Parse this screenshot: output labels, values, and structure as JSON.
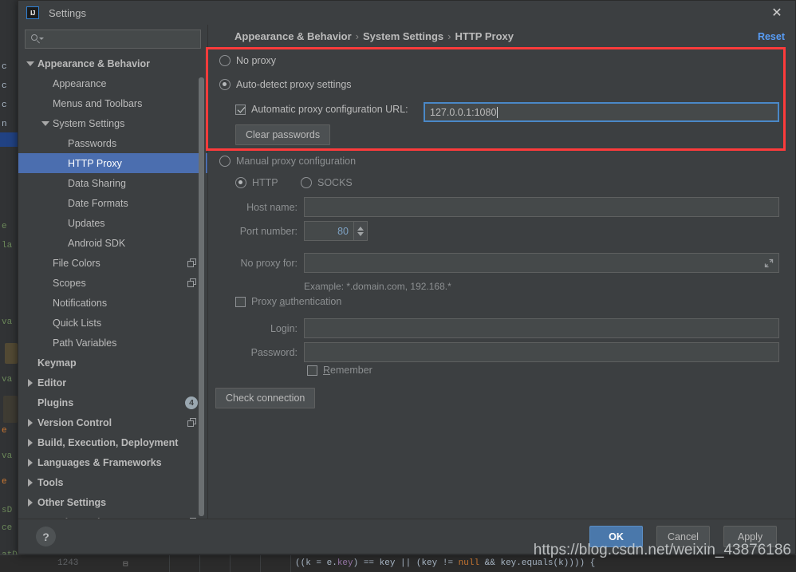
{
  "window": {
    "title": "Settings",
    "logo_text": "IJ",
    "close_label": "✕"
  },
  "search": {
    "value": "",
    "placeholder": ""
  },
  "sidebar": {
    "items": [
      {
        "label": "Appearance & Behavior",
        "indent": 0,
        "twisty": "down",
        "bold": true,
        "selected": false,
        "icon": "",
        "badge": ""
      },
      {
        "label": "Appearance",
        "indent": 1,
        "twisty": "none",
        "bold": false,
        "selected": false,
        "icon": "",
        "badge": ""
      },
      {
        "label": "Menus and Toolbars",
        "indent": 1,
        "twisty": "none",
        "bold": false,
        "selected": false,
        "icon": "",
        "badge": ""
      },
      {
        "label": "System Settings",
        "indent": 1,
        "twisty": "down",
        "bold": false,
        "selected": false,
        "icon": "",
        "badge": ""
      },
      {
        "label": "Passwords",
        "indent": 2,
        "twisty": "none",
        "bold": false,
        "selected": false,
        "icon": "",
        "badge": ""
      },
      {
        "label": "HTTP Proxy",
        "indent": 2,
        "twisty": "none",
        "bold": false,
        "selected": true,
        "icon": "",
        "badge": ""
      },
      {
        "label": "Data Sharing",
        "indent": 2,
        "twisty": "none",
        "bold": false,
        "selected": false,
        "icon": "",
        "badge": ""
      },
      {
        "label": "Date Formats",
        "indent": 2,
        "twisty": "none",
        "bold": false,
        "selected": false,
        "icon": "",
        "badge": ""
      },
      {
        "label": "Updates",
        "indent": 2,
        "twisty": "none",
        "bold": false,
        "selected": false,
        "icon": "",
        "badge": ""
      },
      {
        "label": "Android SDK",
        "indent": 2,
        "twisty": "none",
        "bold": false,
        "selected": false,
        "icon": "",
        "badge": ""
      },
      {
        "label": "File Colors",
        "indent": 1,
        "twisty": "none",
        "bold": false,
        "selected": false,
        "icon": "copy-icon",
        "badge": ""
      },
      {
        "label": "Scopes",
        "indent": 1,
        "twisty": "none",
        "bold": false,
        "selected": false,
        "icon": "copy-icon",
        "badge": ""
      },
      {
        "label": "Notifications",
        "indent": 1,
        "twisty": "none",
        "bold": false,
        "selected": false,
        "icon": "",
        "badge": ""
      },
      {
        "label": "Quick Lists",
        "indent": 1,
        "twisty": "none",
        "bold": false,
        "selected": false,
        "icon": "",
        "badge": ""
      },
      {
        "label": "Path Variables",
        "indent": 1,
        "twisty": "none",
        "bold": false,
        "selected": false,
        "icon": "",
        "badge": ""
      },
      {
        "label": "Keymap",
        "indent": 0,
        "twisty": "none",
        "bold": true,
        "selected": false,
        "icon": "",
        "badge": ""
      },
      {
        "label": "Editor",
        "indent": 0,
        "twisty": "right",
        "bold": true,
        "selected": false,
        "icon": "",
        "badge": ""
      },
      {
        "label": "Plugins",
        "indent": 0,
        "twisty": "none",
        "bold": true,
        "selected": false,
        "icon": "",
        "badge": "4"
      },
      {
        "label": "Version Control",
        "indent": 0,
        "twisty": "right",
        "bold": true,
        "selected": false,
        "icon": "copy-icon",
        "badge": ""
      },
      {
        "label": "Build, Execution, Deployment",
        "indent": 0,
        "twisty": "right",
        "bold": true,
        "selected": false,
        "icon": "",
        "badge": ""
      },
      {
        "label": "Languages & Frameworks",
        "indent": 0,
        "twisty": "right",
        "bold": true,
        "selected": false,
        "icon": "",
        "badge": ""
      },
      {
        "label": "Tools",
        "indent": 0,
        "twisty": "right",
        "bold": true,
        "selected": false,
        "icon": "",
        "badge": ""
      },
      {
        "label": "Other Settings",
        "indent": 0,
        "twisty": "right",
        "bold": true,
        "selected": false,
        "icon": "",
        "badge": ""
      },
      {
        "label": "Experimental",
        "indent": 0,
        "twisty": "none",
        "bold": true,
        "selected": false,
        "icon": "copy-icon",
        "badge": ""
      }
    ]
  },
  "breadcrumb": {
    "part1": "Appearance & Behavior",
    "sep1": "›",
    "part2": "System Settings",
    "sep2": "›",
    "part3": "HTTP Proxy",
    "reset_label": "Reset"
  },
  "proxy": {
    "no_proxy_label": "No proxy",
    "auto_detect_label": "Auto-detect proxy settings",
    "auto_config_url_label": "Automatic proxy configuration URL:",
    "auto_config_url_value": "127.0.0.1:1080",
    "clear_passwords_label": "Clear passwords",
    "manual_label": "Manual proxy configuration",
    "http_label": "HTTP",
    "socks_label": "SOCKS",
    "host_name_label": "Host name:",
    "host_name_value": "",
    "port_number_label": "Port number:",
    "port_number_value": "80",
    "no_proxy_for_label": "No proxy for:",
    "no_proxy_for_value": "",
    "example_hint": "Example: *.domain.com, 192.168.*",
    "proxy_auth_label_pre": "Proxy ",
    "proxy_auth_label_underline": "a",
    "proxy_auth_label_post": "uthentication",
    "login_label": "Login:",
    "login_value": "",
    "password_label": "Password:",
    "password_value": "",
    "remember_label_underline": "R",
    "remember_label_post": "emember",
    "check_connection_label": "Check connection"
  },
  "footer": {
    "help_label": "?",
    "ok_label": "OK",
    "cancel_label": "Cancel",
    "apply_label": "Apply"
  },
  "watermark": {
    "text": "https://blog.csdn.net/weixin_43876186"
  },
  "background": {
    "line_number": "1243",
    "code_pre": "((k = e.",
    "code_field": "key",
    "code_mid": ") == key || (key != ",
    "code_kw": "null",
    "code_post": " && key.equals(k)))) {"
  },
  "colors": {
    "accent_blue": "#4b6eaf",
    "link_blue": "#589df6",
    "highlight_red": "#fd3b3b",
    "panel_bg": "#3c3f41",
    "field_bg": "#45494a",
    "text": "#bbbbbb"
  }
}
